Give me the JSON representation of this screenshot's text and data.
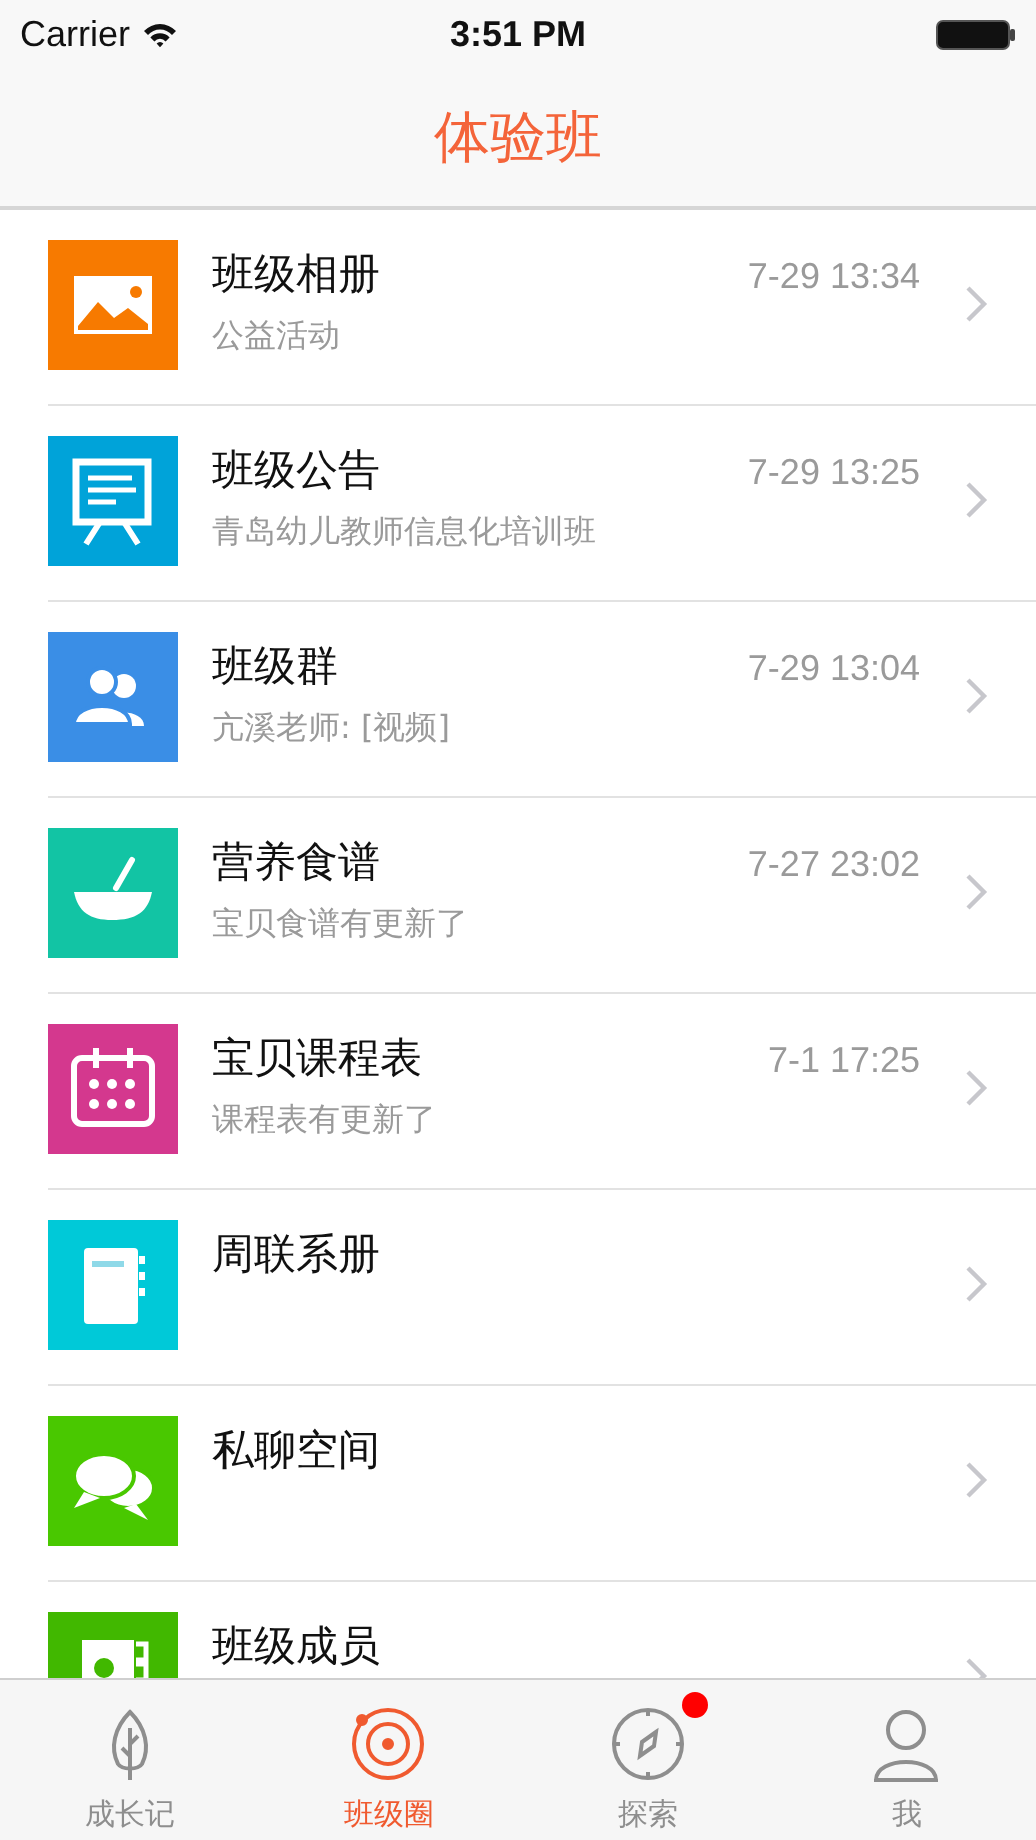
{
  "status_bar": {
    "carrier": "Carrier",
    "time": "3:51 PM"
  },
  "nav_bar": {
    "title": "体验班"
  },
  "list": [
    {
      "kind": "picture",
      "color": "#f77a00",
      "title": "班级相册",
      "subtitle": "公益活动",
      "time": "7-29 13:34"
    },
    {
      "kind": "board",
      "color": "#00a3d9",
      "title": "班级公告",
      "subtitle": "青岛幼儿教师信息化培训班",
      "time": "7-29 13:25"
    },
    {
      "kind": "group",
      "color": "#3a8ee6",
      "title": "班级群",
      "subtitle": "亢溪老师: [视频]",
      "time": "7-29 13:04"
    },
    {
      "kind": "bowl",
      "color": "#12c4a4",
      "title": "营养食谱",
      "subtitle": "宝贝食谱有更新了",
      "time": "7-27 23:02"
    },
    {
      "kind": "calendar",
      "color": "#d4388e",
      "title": "宝贝课程表",
      "subtitle": "课程表有更新了",
      "time": "7-1 17:25"
    },
    {
      "kind": "book",
      "color": "#00c9d8",
      "title": "周联系册"
    },
    {
      "kind": "chat",
      "color": "#49c800",
      "title": "私聊空间"
    },
    {
      "kind": "contacts",
      "color": "#41b800",
      "title": "班级成员"
    }
  ],
  "tab_bar": [
    {
      "kind": "leaf",
      "label": "成长记",
      "selected": false,
      "badge": false
    },
    {
      "kind": "target",
      "label": "班级圈",
      "selected": true,
      "badge": false
    },
    {
      "kind": "compass",
      "label": "探索",
      "selected": false,
      "badge": true
    },
    {
      "kind": "person",
      "label": "我",
      "selected": false,
      "badge": false
    }
  ]
}
